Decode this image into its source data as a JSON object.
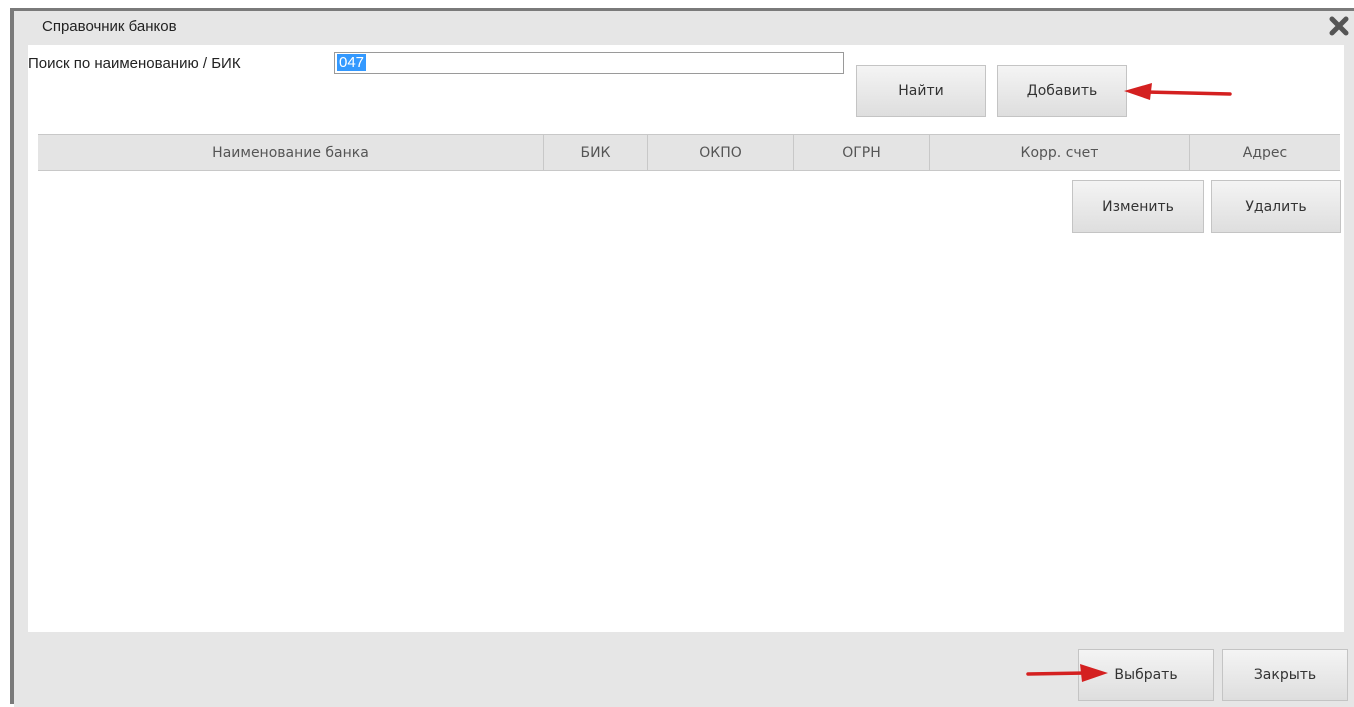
{
  "dialog": {
    "title": "Справочник банков",
    "close_icon": "close-x-icon"
  },
  "search": {
    "label": "Поиск по наименованию / БИК",
    "value": "047",
    "find_button": "Найти",
    "add_button": "Добавить"
  },
  "table": {
    "columns": [
      "Наименование банка",
      "БИК",
      "ОКПО",
      "ОГРН",
      "Корр. счет",
      "Адрес"
    ],
    "rows": []
  },
  "row_actions": {
    "edit_button": "Изменить",
    "delete_button": "Удалить"
  },
  "footer": {
    "select_button": "Выбрать",
    "close_button": "Закрыть"
  },
  "colors": {
    "annotation_arrow": "#d42020",
    "selection": "#3399ff"
  }
}
